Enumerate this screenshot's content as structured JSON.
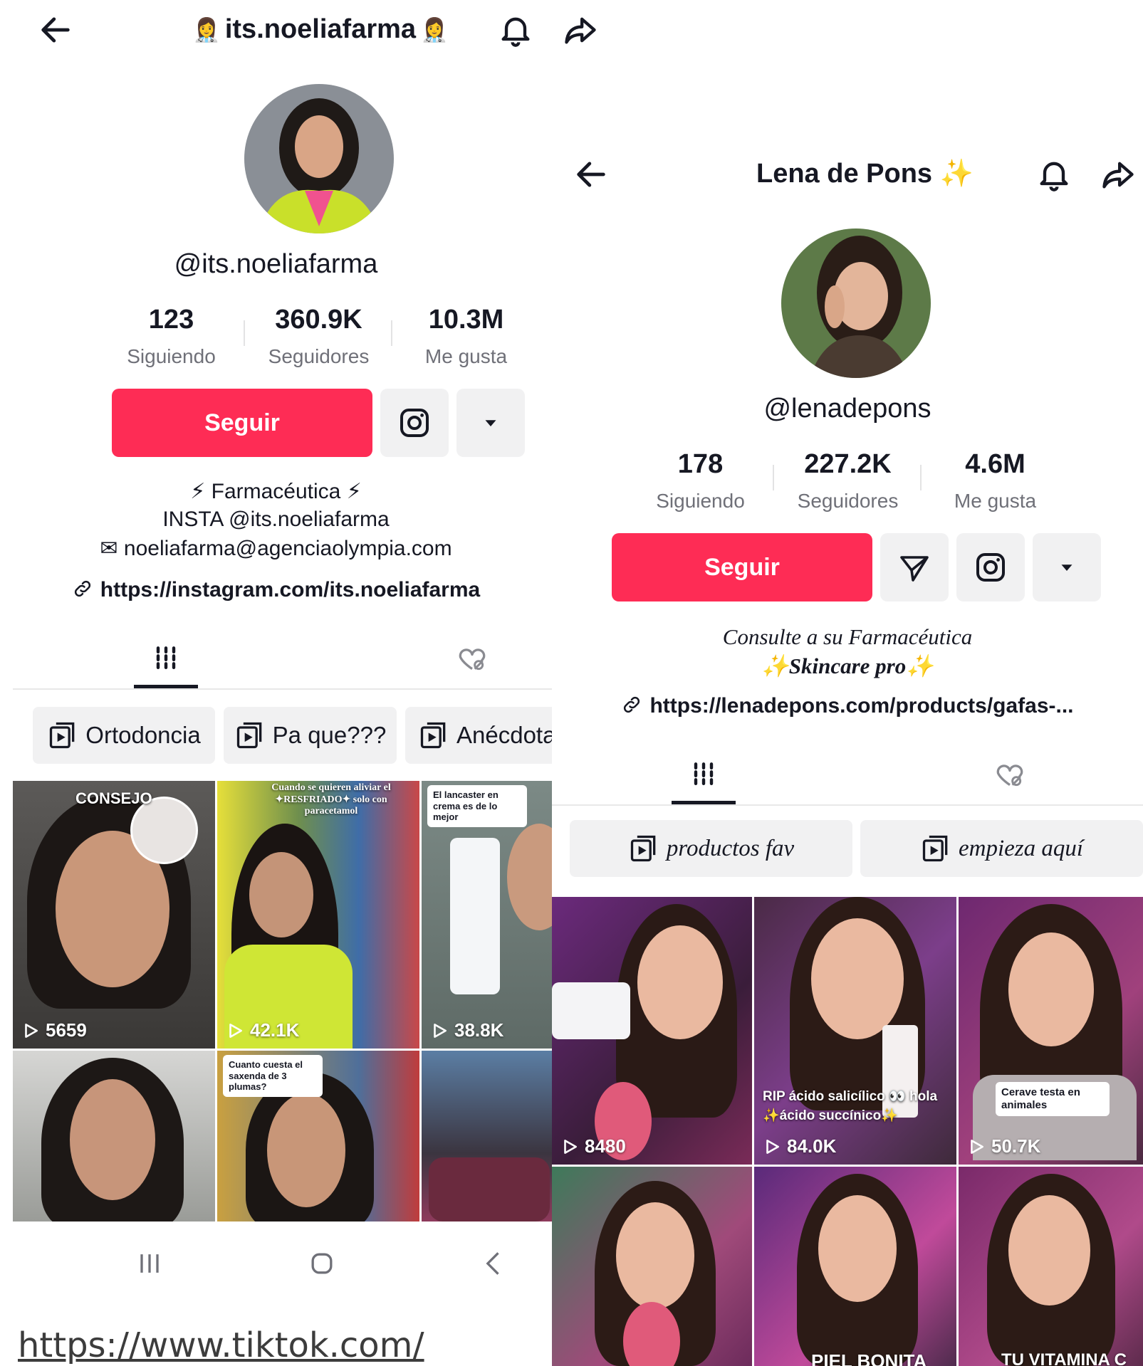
{
  "left": {
    "header": {
      "title": "its.noeliafarma",
      "back_icon": "back-arrow-icon",
      "bell_icon": "bell-icon",
      "share_icon": "share-icon"
    },
    "handle": "@its.noeliafarma",
    "stats": [
      {
        "value": "123",
        "label": "Siguiendo"
      },
      {
        "value": "360.9K",
        "label": "Seguidores"
      },
      {
        "value": "10.3M",
        "label": "Me gusta"
      }
    ],
    "follow_label": "Seguir",
    "bio": [
      "⚡ Farmacéutica ⚡",
      "INSTA @its.noeliafarma",
      "✉ noeliafarma@agenciaolympia.com"
    ],
    "link": "https://instagram.com/its.noeliafarma",
    "playlists": [
      "Ortodoncia",
      "Pa que???",
      "Anécdota"
    ],
    "videos": [
      {
        "views": "5659",
        "overlay": "CONSEJO"
      },
      {
        "views": "42.1K",
        "overlay": "Cuando se quieren aliviar el ✦RESFRIADO✦ solo con paracetamol"
      },
      {
        "views": "38.8K",
        "overlay": "El lancaster en crema es de lo mejor"
      },
      {
        "views": "",
        "overlay": ""
      },
      {
        "views": "",
        "overlay": "Cuanto cuesta el saxenda de 3 plumas?"
      },
      {
        "views": "",
        "overlay": ""
      }
    ]
  },
  "right": {
    "header": {
      "title": "Lena de Pons ✨",
      "back_icon": "back-arrow-icon",
      "bell_icon": "bell-icon",
      "share_icon": "share-icon"
    },
    "handle": "@lenadepons",
    "stats": [
      {
        "value": "178",
        "label": "Siguiendo"
      },
      {
        "value": "227.2K",
        "label": "Seguidores"
      },
      {
        "value": "4.6M",
        "label": "Me gusta"
      }
    ],
    "follow_label": "Seguir",
    "bio": [
      "Consulte a su Farmacéutica",
      "✨Skincare pro✨"
    ],
    "link": "https://lenadepons.com/products/gafas-...",
    "playlists": [
      "productos fav",
      "empieza aquí"
    ],
    "videos": [
      {
        "views": "8480",
        "overlay": ""
      },
      {
        "views": "84.0K",
        "overlay": "RIP ácido salicílico 👀 hola ✨ácido succínico✨"
      },
      {
        "views": "50.7K",
        "overlay": "Cerave testa en animales"
      },
      {
        "views": "",
        "overlay": ""
      },
      {
        "views": "",
        "overlay": "PIEL BONITA"
      },
      {
        "views": "",
        "overlay": "TU VITAMINA C"
      }
    ]
  },
  "nav": {
    "recents_icon": "recents-icon",
    "home_icon": "home-icon",
    "back_icon": "back-chevron-icon"
  },
  "caption_url": "https://www.tiktok.com/",
  "colors": {
    "accent": "#fe2c55",
    "secondary_button": "#f1f1f2",
    "text": "#161823",
    "muted": "#6f7078"
  }
}
